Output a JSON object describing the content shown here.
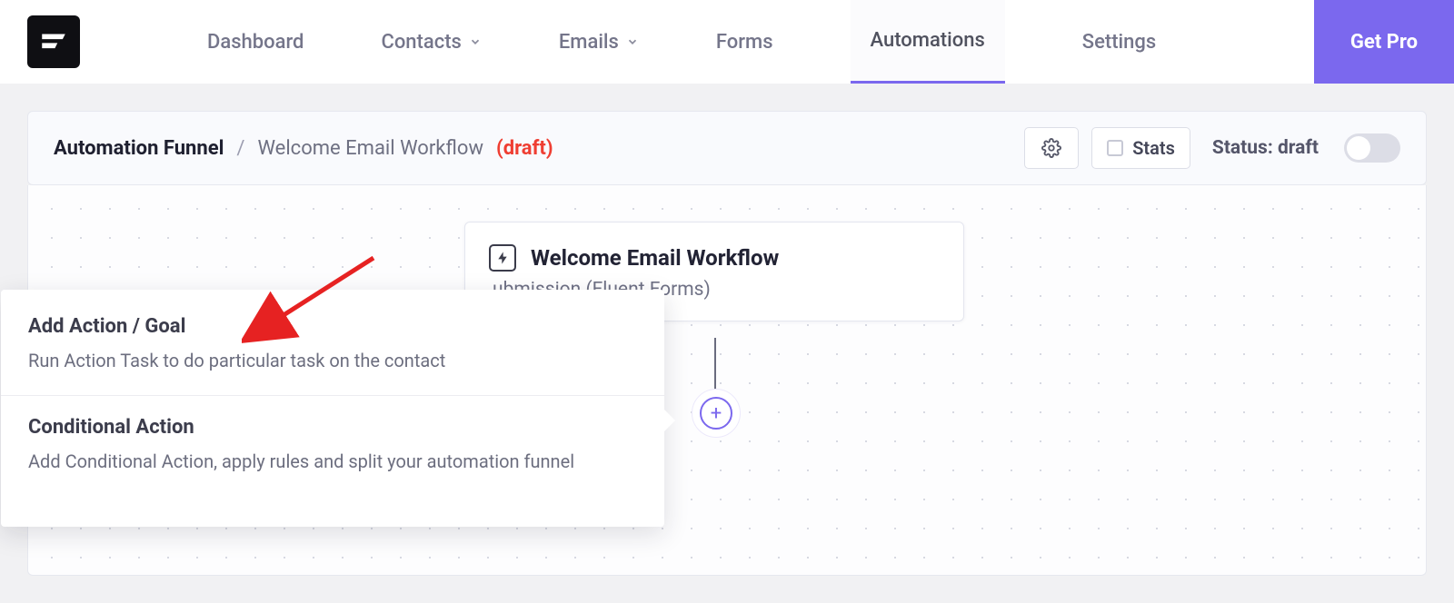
{
  "nav": {
    "items": [
      {
        "label": "Dashboard",
        "has_chevron": false
      },
      {
        "label": "Contacts",
        "has_chevron": true
      },
      {
        "label": "Emails",
        "has_chevron": true
      },
      {
        "label": "Forms",
        "has_chevron": false
      },
      {
        "label": "Automations",
        "has_chevron": false,
        "active": true
      },
      {
        "label": "Settings",
        "has_chevron": false
      }
    ],
    "getpro_label": "Get Pro"
  },
  "header": {
    "funnel_label": "Automation Funnel",
    "separator": "/",
    "workflow_name": "Welcome Email Workflow",
    "draft_label": "(draft)",
    "stats_label": "Stats",
    "status_label": "Status: draft"
  },
  "node": {
    "title": "Welcome Email Workflow",
    "subtitle": "ubmission (Fluent Forms)"
  },
  "popup": {
    "items": [
      {
        "title": "Add Action / Goal",
        "desc": "Run Action Task to do particular task on the contact"
      },
      {
        "title": "Conditional Action",
        "desc": "Add Conditional Action, apply rules and split your automation funnel"
      }
    ]
  }
}
